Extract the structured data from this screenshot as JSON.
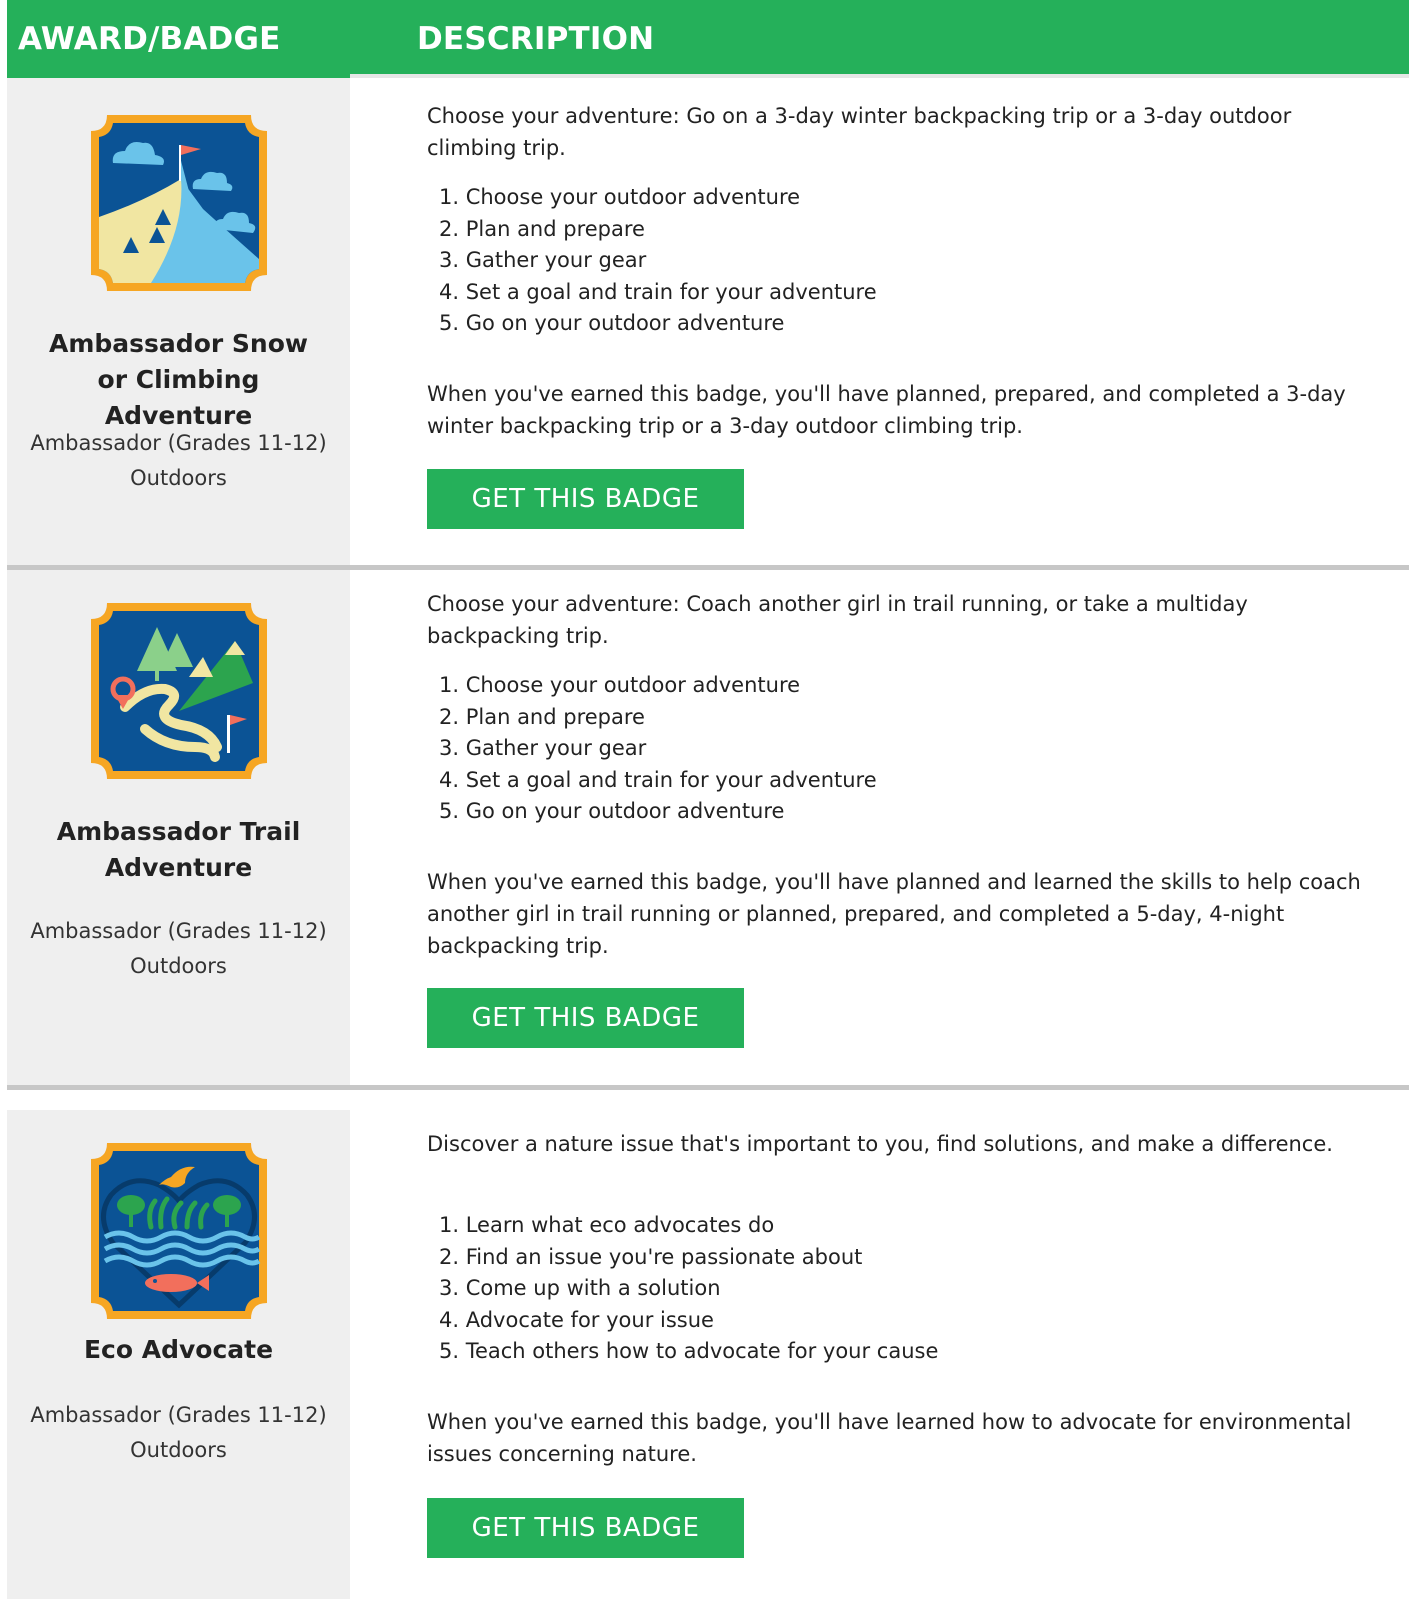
{
  "header": {
    "award_label": "AWARD/BADGE",
    "description_label": "DESCRIPTION"
  },
  "colors": {
    "header_green": "#25b05a",
    "button_green": "#25b05a",
    "left_panel": "#efefef",
    "badge_navy": "#0b5395",
    "badge_border": "#f6a623"
  },
  "badges": [
    {
      "icon": "snow-climbing-mountain-badge-icon",
      "title_lines": [
        "Ambassador Snow",
        "or Climbing",
        "Adventure"
      ],
      "level": "Ambassador (Grades 11-12)",
      "category": "Outdoors",
      "intro_lines": [
        "Choose your adventure: Go on a 3-day winter backpacking trip or a 3-day outdoor",
        "climbing trip."
      ],
      "steps": [
        "1. Choose your outdoor adventure",
        "2. Plan and prepare",
        "3. Gather your gear",
        "4. Set a goal and train for your adventure",
        "5. Go on your outdoor adventure"
      ],
      "outcome_lines": [
        "When you've earned this badge, you'll have planned, prepared, and completed a 3-day",
        "winter backpacking trip or a 3-day outdoor climbing trip."
      ],
      "button_label": "GET THIS BADGE"
    },
    {
      "icon": "trail-adventure-badge-icon",
      "title_lines": [
        "Ambassador Trail",
        "Adventure"
      ],
      "level": "Ambassador (Grades 11-12)",
      "category": "Outdoors",
      "intro_lines": [
        "Choose your adventure: Coach another girl in trail running, or take a multiday",
        "backpacking trip."
      ],
      "steps": [
        "1. Choose your outdoor adventure",
        "2. Plan and prepare",
        "3. Gather your gear",
        "4. Set a goal and train for your adventure",
        "5. Go on your outdoor adventure"
      ],
      "outcome_lines": [
        "When you've earned this badge, you'll have planned and learned the skills to help coach",
        "another girl in trail running or planned, prepared, and completed a 5-day, 4-night",
        "backpacking trip."
      ],
      "button_label": "GET THIS BADGE"
    },
    {
      "icon": "eco-advocate-badge-icon",
      "title_lines": [
        "Eco Advocate"
      ],
      "level": "Ambassador (Grades 11-12)",
      "category": "Outdoors",
      "intro_lines": [
        "Discover a nature issue that's important to you, find solutions, and make a difference."
      ],
      "steps": [
        "1. Learn what eco advocates do",
        "2. Find an issue you're passionate about",
        "3. Come up with a solution",
        "4. Advocate for your issue",
        "5. Teach others how to advocate for your cause"
      ],
      "outcome_lines": [
        "When you've earned this badge, you'll have learned how to advocate for environmental",
        "issues concerning nature."
      ],
      "button_label": "GET THIS BADGE"
    }
  ]
}
